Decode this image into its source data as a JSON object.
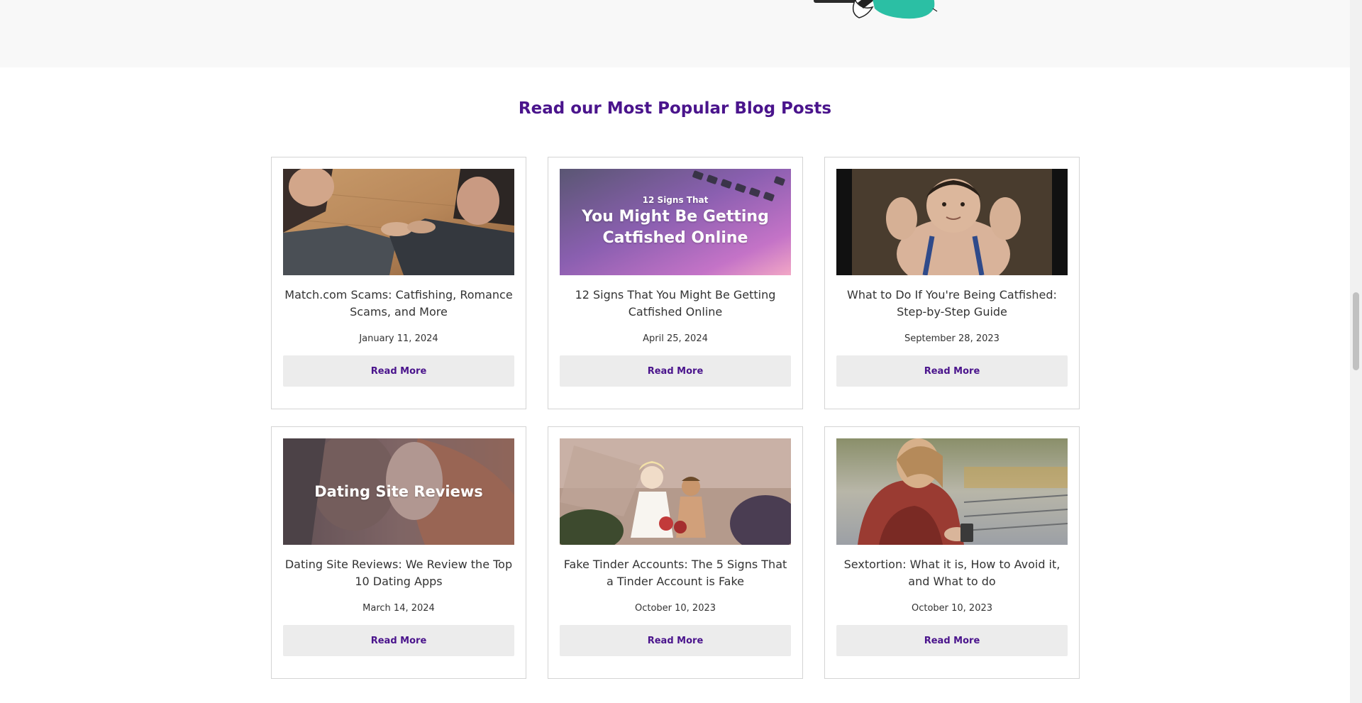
{
  "section": {
    "title": "Read our Most Popular Blog Posts"
  },
  "posts": [
    {
      "title": "Match.com Scams: Catfishing, Romance Scams, and More",
      "date": "January 11, 2024",
      "read_more_label": "Read More",
      "image": "couple-holding-hands-on-table"
    },
    {
      "title": "12 Signs That You Might Be Getting Catfished Online",
      "date": "April 25, 2024",
      "read_more_label": "Read More",
      "image": "laptop-gradient-overlay",
      "overlay_small": "12 Signs That",
      "overlay_line1": "You Might Be Getting",
      "overlay_line2": "Catfished Online"
    },
    {
      "title": "What to Do If You're Being Catfished: Step-by-Step Guide",
      "date": "September 28, 2023",
      "read_more_label": "Read More",
      "image": "child-flexing-muscles"
    },
    {
      "title": "Dating Site Reviews: We Review the Top 10 Dating Apps",
      "date": "March 14, 2024",
      "read_more_label": "Read More",
      "image": "couple-embracing-overlay",
      "overlay_text": "Dating Site Reviews"
    },
    {
      "title": "Fake Tinder Accounts: The 5 Signs That a Tinder Account is Fake",
      "date": "October 10, 2023",
      "read_more_label": "Read More",
      "image": "dolls-figurines"
    },
    {
      "title": "Sextortion: What it is, How to Avoid it, and What to do",
      "date": "October 10, 2023",
      "read_more_label": "Read More",
      "image": "woman-looking-at-phone"
    }
  ],
  "colors": {
    "accent": "#4a148c",
    "button_bg": "#ececec",
    "card_border": "#d4d4d4",
    "hero_bg": "#f8f8f8"
  }
}
